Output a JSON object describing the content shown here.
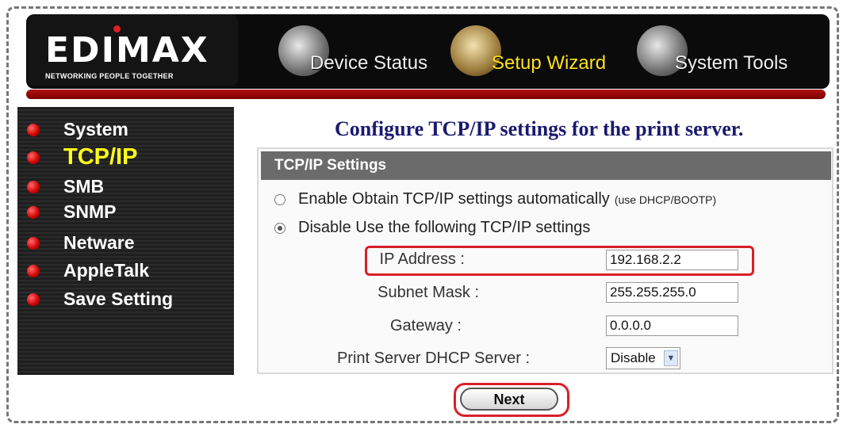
{
  "header": {
    "logo_text": "EDIMAX",
    "logo_tagline": "NETWORKING PEOPLE TOGETHER",
    "nav": [
      {
        "label": "Device Status",
        "icon": "globe-icon",
        "active": false
      },
      {
        "label": "Setup Wizard",
        "icon": "wizard-icon",
        "active": true
      },
      {
        "label": "System Tools",
        "icon": "tools-icon",
        "active": false
      }
    ]
  },
  "sidebar": {
    "items": [
      {
        "label": "System",
        "active": false
      },
      {
        "label": "TCP/IP",
        "active": true
      },
      {
        "label": "SMB",
        "active": false
      },
      {
        "label": "SNMP",
        "active": false
      },
      {
        "label": "Netware",
        "active": false
      },
      {
        "label": "AppleTalk",
        "active": false
      },
      {
        "label": "Save Setting",
        "active": false
      }
    ]
  },
  "main": {
    "title": "Configure TCP/IP settings for the print server.",
    "panel_title": "TCP/IP Settings",
    "radio_auto": {
      "label": "Enable Obtain TCP/IP settings automatically",
      "note": "(use DHCP/BOOTP)",
      "checked": false
    },
    "radio_manual": {
      "label": "Disable Use the following TCP/IP settings",
      "checked": true
    },
    "fields": {
      "ip_label": "IP Address :",
      "ip_value": "192.168.2.2",
      "subnet_label": "Subnet Mask :",
      "subnet_value": "255.255.255.0",
      "gateway_label": "Gateway :",
      "gateway_value": "0.0.0.0",
      "dhcp_label": "Print Server DHCP Server :",
      "dhcp_value": "Disable"
    },
    "next_label": "Next"
  },
  "colors": {
    "highlight": "#d8202a",
    "active_text": "#ffff1a",
    "title_text": "#1a1a70"
  }
}
